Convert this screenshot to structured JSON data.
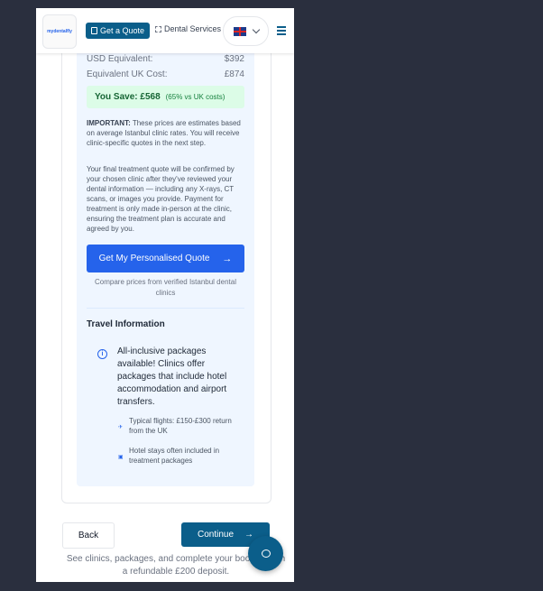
{
  "header": {
    "logo_text": "mydentalfly",
    "quote_button": "Get a Quote",
    "dental_link": "Dental Services",
    "language_flag": "uk-flag",
    "menu_icon": "hamburger-icon"
  },
  "costs": {
    "usd_label": "USD Equivalent:",
    "usd_value": "$392",
    "uk_label": "Equivalent UK Cost:",
    "uk_value": "£874",
    "save_label": "You Save: £568",
    "save_note": "(65% vs UK costs)"
  },
  "notes": {
    "important_label": "IMPORTANT:",
    "important_text": " These prices are estimates based on average Istanbul clinic rates. You will receive clinic-specific quotes in the next step.",
    "final_text": "Your final treatment quote will be confirmed by your chosen clinic after they've reviewed your dental information — including any X-rays, CT scans, or images you provide. Payment for treatment is only made in-person at the clinic, ensuring the treatment plan is accurate and agreed by you."
  },
  "cta": {
    "label": "Get My Personalised Quote",
    "compare_text": "Compare prices from verified Istanbul dental clinics"
  },
  "travel": {
    "title": "Travel Information",
    "info": "All-inclusive packages available! Clinics offer packages that include hotel accommodation and airport transfers.",
    "flights": "Typical flights: £150-£300 return from the UK",
    "hotels": "Hotel stays often included in treatment packages"
  },
  "nav": {
    "back": "Back",
    "continue": "Continue",
    "footer": "See clinics, packages, and complete your booking with a refundable £200 deposit."
  },
  "colors": {
    "primary": "#0b5e8a",
    "cta_blue": "#2563eb",
    "save_bg": "#dcfce7",
    "panel_bg": "#eff6ff"
  }
}
